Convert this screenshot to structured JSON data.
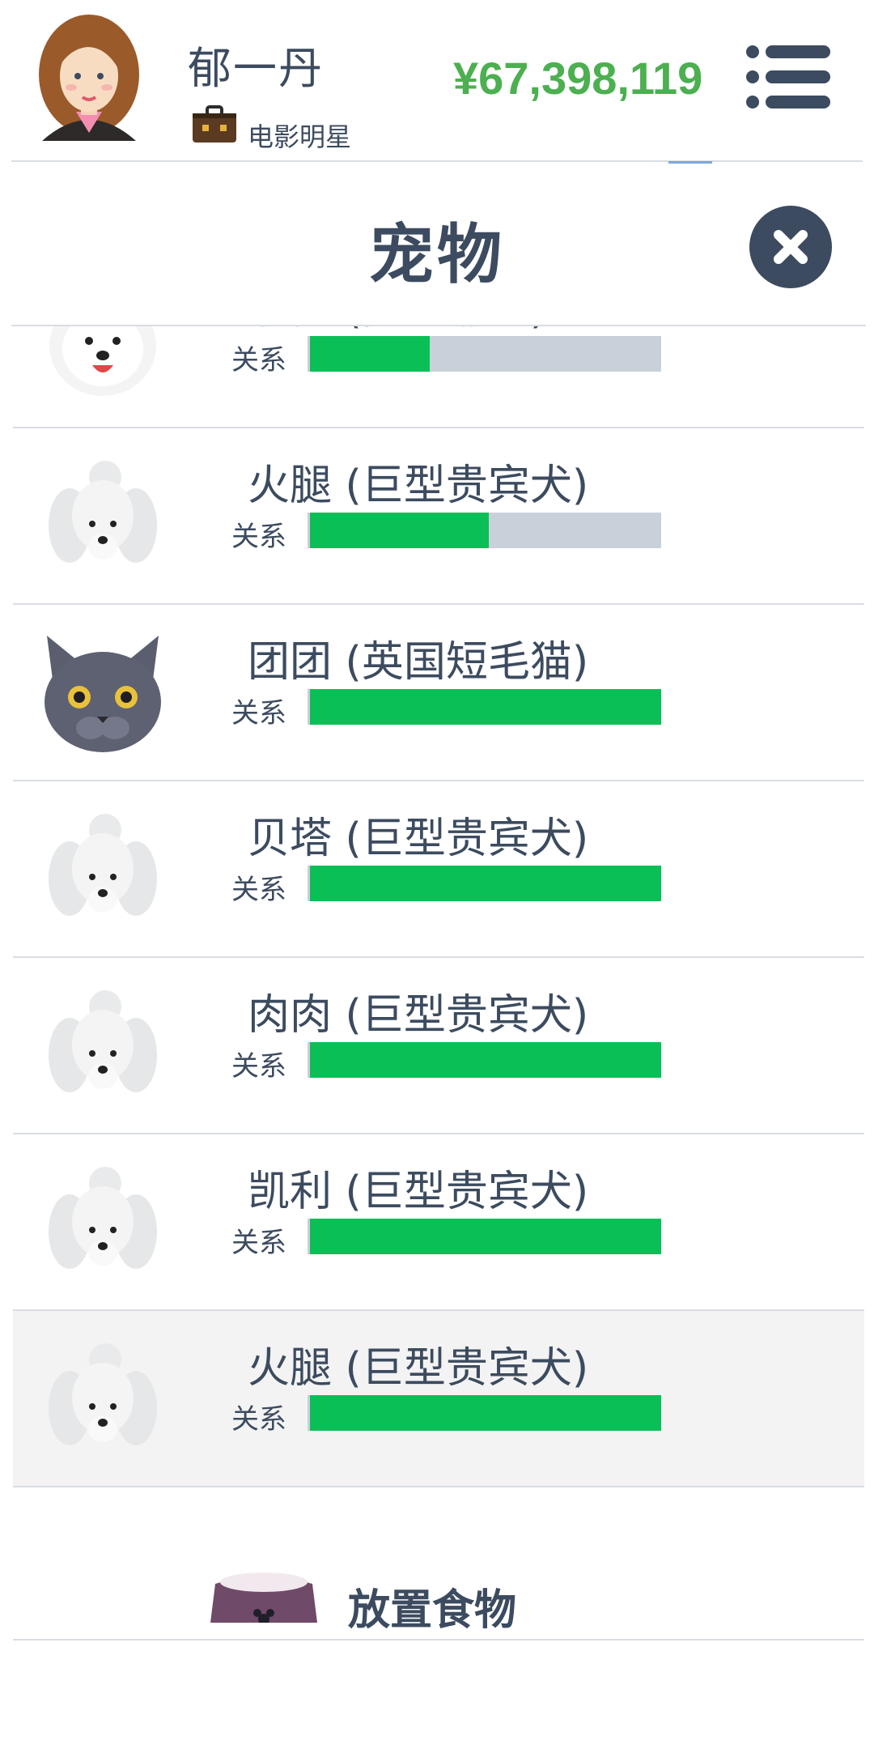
{
  "header": {
    "player_name": "郁一丹",
    "job_title": "电影明星",
    "money": "¥67,398,119",
    "avatar_icon": "female-avatar-icon",
    "job_icon": "briefcase-icon",
    "menu_icon": "hamburger-menu-icon"
  },
  "panel": {
    "title": "宠物",
    "close_icon": "close-icon"
  },
  "relationship_label": "关系",
  "pets": [
    {
      "name": "小白 (萨摩耶犬)",
      "icon": "samoyed-icon",
      "relationship": 0.34
    },
    {
      "name": "火腿 (巨型贵宾犬)",
      "icon": "poodle-icon",
      "relationship": 0.51
    },
    {
      "name": "团团 (英国短毛猫)",
      "icon": "british-shorthair-cat-icon",
      "relationship": 1.0
    },
    {
      "name": "贝塔 (巨型贵宾犬)",
      "icon": "poodle-icon",
      "relationship": 1.0
    },
    {
      "name": "肉肉 (巨型贵宾犬)",
      "icon": "poodle-icon",
      "relationship": 1.0
    },
    {
      "name": "凯利 (巨型贵宾犬)",
      "icon": "poodle-icon",
      "relationship": 1.0
    },
    {
      "name": "火腿 (巨型贵宾犬)",
      "icon": "poodle-icon",
      "relationship": 1.0,
      "selected": true
    }
  ],
  "food": {
    "label": "放置食物",
    "icon": "pet-bowl-icon"
  },
  "colors": {
    "money": "#4caf50",
    "bar_fill": "#0bbf57",
    "bar_track": "#c8d0da",
    "text": "#3c4b5f"
  }
}
